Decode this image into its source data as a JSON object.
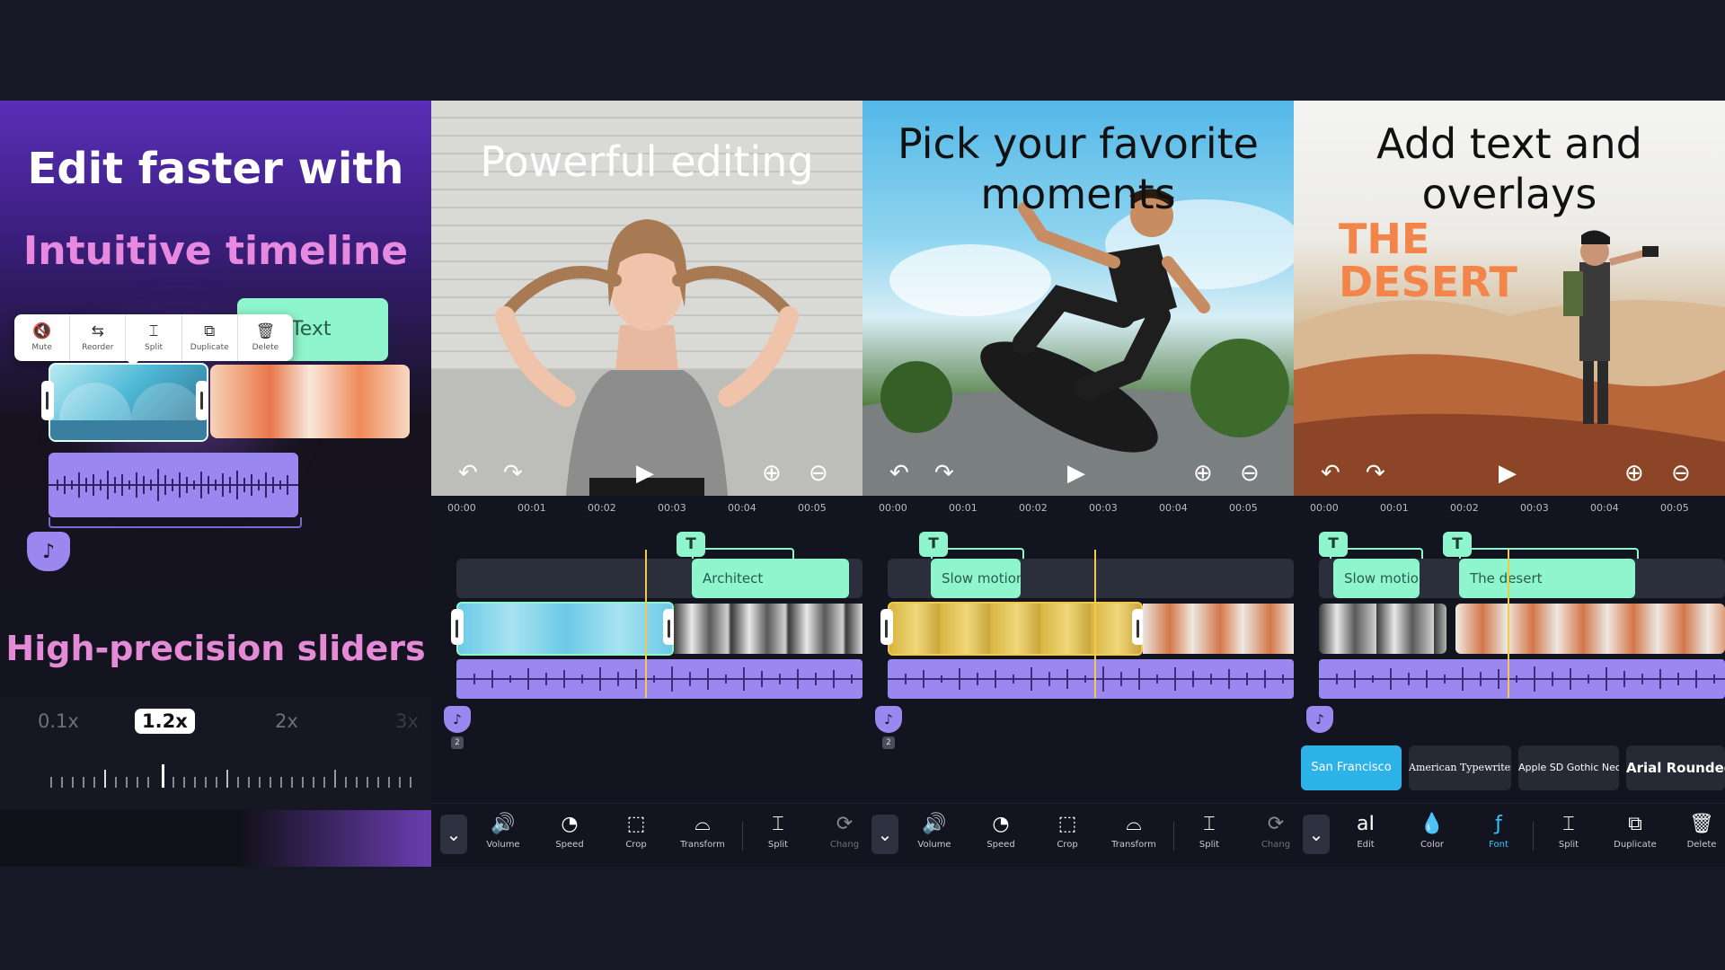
{
  "panel1": {
    "title_line1": "Edit faster with",
    "title_line2": "Intuitive timeline",
    "title_line3": "High-precision sliders",
    "context_menu": [
      {
        "icon": "mute-icon",
        "glyph": "🔇",
        "label": "Mute"
      },
      {
        "icon": "reorder-icon",
        "glyph": "⇆",
        "label": "Reorder"
      },
      {
        "icon": "split-icon",
        "glyph": "⌶",
        "label": "Split"
      },
      {
        "icon": "duplicate-icon",
        "glyph": "⧉",
        "label": "Duplicate"
      },
      {
        "icon": "delete-icon",
        "glyph": "🗑",
        "label": "Delete"
      }
    ],
    "text_clip_label": "Text",
    "speed_values": [
      "0.1x",
      "1.2x",
      "2x",
      "3x"
    ],
    "selected_speed": "1.2x"
  },
  "panel2": {
    "headline": "Powerful editing",
    "ruler": [
      "00:00",
      "00:01",
      "00:02",
      "00:03",
      "00:04",
      "00:05"
    ],
    "text_clip": "Architect",
    "audio_count": "2",
    "tools": [
      {
        "name": "volume",
        "glyph": "🔊",
        "label": "Volume"
      },
      {
        "name": "speed",
        "glyph": "◔",
        "label": "Speed"
      },
      {
        "name": "crop",
        "glyph": "⬚",
        "label": "Crop"
      },
      {
        "name": "transform",
        "glyph": "⌓",
        "label": "Transform"
      },
      {
        "name": "split",
        "glyph": "⌶",
        "label": "Split"
      },
      {
        "name": "change",
        "glyph": "⟳",
        "label": "Chang"
      }
    ]
  },
  "panel3": {
    "headline_line1": "Pick your favorite",
    "headline_line2": "moments",
    "ruler": [
      "00:00",
      "00:01",
      "00:02",
      "00:03",
      "00:04",
      "00:05"
    ],
    "text_clip": "Slow motion",
    "audio_count": "2",
    "tools": [
      {
        "name": "volume",
        "glyph": "🔊",
        "label": "Volume"
      },
      {
        "name": "speed",
        "glyph": "◔",
        "label": "Speed"
      },
      {
        "name": "crop",
        "glyph": "⬚",
        "label": "Crop"
      },
      {
        "name": "transform",
        "glyph": "⌓",
        "label": "Transform"
      },
      {
        "name": "split",
        "glyph": "⌶",
        "label": "Split"
      },
      {
        "name": "change",
        "glyph": "⟳",
        "label": "Chang"
      }
    ]
  },
  "panel4": {
    "headline_line1": "Add text and",
    "headline_line2": "overlays",
    "overlay_line1": "THE",
    "overlay_line2": "DESERT",
    "ruler": [
      "00:00",
      "00:01",
      "00:02",
      "00:03",
      "00:04",
      "00:05"
    ],
    "text_clip_1": "Slow motion",
    "text_clip_2": "The desert",
    "fonts": [
      "San Francisco",
      "American Typewriter",
      "Apple SD Gothic Neo",
      "Arial Rounded"
    ],
    "selected_font": "San Francisco",
    "tools": [
      {
        "name": "edit",
        "glyph": "aI",
        "label": "Edit"
      },
      {
        "name": "color",
        "glyph": "💧",
        "label": "Color"
      },
      {
        "name": "font",
        "glyph": "ƒ",
        "label": "Font"
      },
      {
        "name": "split",
        "glyph": "⌶",
        "label": "Split"
      },
      {
        "name": "duplicate",
        "glyph": "⧉",
        "label": "Duplicate"
      },
      {
        "name": "delete",
        "glyph": "🗑",
        "label": "Delete"
      }
    ],
    "active_tool": "Font"
  },
  "colors": {
    "background": "#161826",
    "text_track": "#8ef5cc",
    "audio_track": "#9b87f0",
    "playhead": "#f2c94c",
    "selected_font_chip": "#2db3e8",
    "overlay_text": "#f3854a"
  }
}
